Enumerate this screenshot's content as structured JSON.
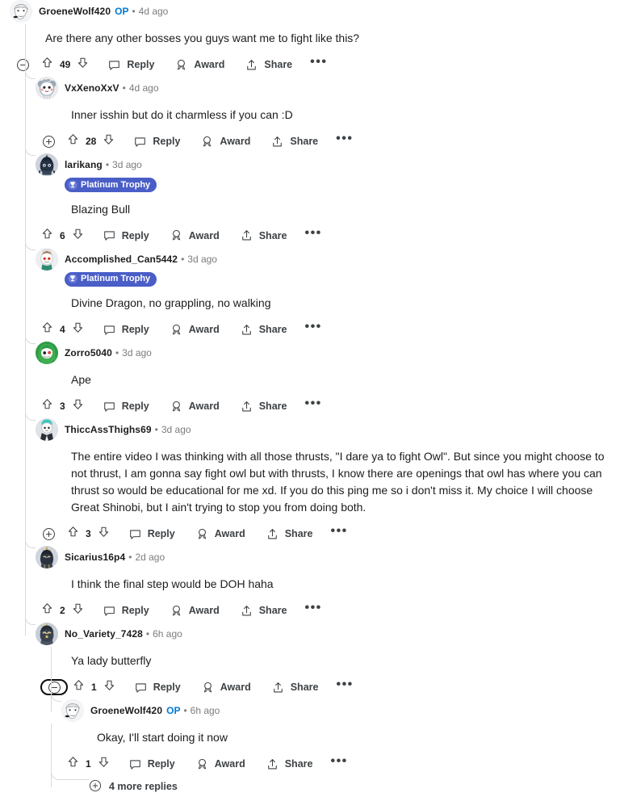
{
  "theme": {
    "background": "#ffffff",
    "text": "#1c1c1c",
    "meta_text": "#7c7c7c",
    "action_text": "#3d4144",
    "op_color": "#0079d3",
    "thread_line": "#d9dadb",
    "flair_bg": "#4a5ec7",
    "flair_text": "#ffffff"
  },
  "labels": {
    "reply": "Reply",
    "award": "Award",
    "share": "Share",
    "more_menu": "•••",
    "separator": "•"
  },
  "icons": {
    "collapse": "minus-circle-icon",
    "expand": "plus-circle-icon",
    "upvote": "upvote-arrow-icon",
    "downvote": "downvote-arrow-icon",
    "reply": "speech-bubble-icon",
    "award": "award-ribbon-icon",
    "share": "share-arrow-icon",
    "more": "ellipsis-icon",
    "flair": "trophy-icon"
  },
  "comments": [
    {
      "id": "c1",
      "depth": 0,
      "username": "GroeneWolf420",
      "is_op": true,
      "op_label": "OP",
      "timestamp": "4d ago",
      "flair": null,
      "body": "Are there any other bosses you guys want me to fight like this?",
      "votes": "49",
      "collapse_state": "collapse",
      "collapse_focused": false,
      "avatar": "sketch-face-avatar"
    },
    {
      "id": "c2",
      "depth": 1,
      "username": "VxXenoXxV",
      "is_op": false,
      "op_label": "",
      "timestamp": "4d ago",
      "flair": null,
      "body": "Inner isshin but do it charmless if you can :D",
      "votes": "28",
      "collapse_state": "expand",
      "collapse_focused": false,
      "avatar": "grey-koala-avatar"
    },
    {
      "id": "c3",
      "depth": 1,
      "username": "larikang",
      "is_op": false,
      "op_label": "",
      "timestamp": "3d ago",
      "flair": "Platinum Trophy",
      "body": "Blazing Bull",
      "votes": "6",
      "collapse_state": "none",
      "collapse_focused": false,
      "avatar": "dark-knight-avatar"
    },
    {
      "id": "c4",
      "depth": 1,
      "username": "Accomplished_Can5442",
      "is_op": false,
      "op_label": "",
      "timestamp": "3d ago",
      "flair": "Platinum Trophy",
      "body": "Divine Dragon, no grappling, no walking",
      "votes": "4",
      "collapse_state": "none",
      "collapse_focused": false,
      "avatar": "snoo-chef-avatar"
    },
    {
      "id": "c5",
      "depth": 1,
      "username": "Zorro5040",
      "is_op": false,
      "op_label": "",
      "timestamp": "3d ago",
      "flair": null,
      "body": "Ape",
      "votes": "3",
      "collapse_state": "none",
      "collapse_focused": false,
      "avatar": "green-hair-avatar"
    },
    {
      "id": "c6",
      "depth": 1,
      "username": "ThiccAssThighs69",
      "is_op": false,
      "op_label": "",
      "timestamp": "3d ago",
      "flair": null,
      "body": "The entire video I was thinking with all those thrusts, \"I dare ya to fight Owl\". But since you might choose to not thrust, I am gonna say fight owl but with thrusts, I know there are openings that owl has where you can thrust so would be educational for me xd. If you do this ping me so i don't miss it. My choice I will choose Great Shinobi, but I ain't trying to stop you from doing both.",
      "votes": "3",
      "collapse_state": "expand",
      "collapse_focused": false,
      "avatar": "teal-hair-suit-avatar"
    },
    {
      "id": "c7",
      "depth": 1,
      "username": "Sicarius16p4",
      "is_op": false,
      "op_label": "",
      "timestamp": "2d ago",
      "flair": null,
      "body": "I think the final step would be DOH haha",
      "votes": "2",
      "collapse_state": "none",
      "collapse_focused": false,
      "avatar": "dark-armor-avatar"
    },
    {
      "id": "c8",
      "depth": 1,
      "username": "No_Variety_7428",
      "is_op": false,
      "op_label": "",
      "timestamp": "6h ago",
      "flair": null,
      "body": "Ya lady butterfly",
      "votes": "1",
      "collapse_state": "collapse",
      "collapse_focused": true,
      "avatar": "gold-armor-avatar"
    },
    {
      "id": "c9",
      "depth": 2,
      "username": "GroeneWolf420",
      "is_op": true,
      "op_label": "OP",
      "timestamp": "6h ago",
      "flair": null,
      "body": "Okay, I'll start doing it now",
      "votes": "1",
      "collapse_state": "none",
      "collapse_focused": false,
      "avatar": "sketch-face-avatar"
    }
  ],
  "more_replies": {
    "label": "4 more replies",
    "depth": 2
  }
}
